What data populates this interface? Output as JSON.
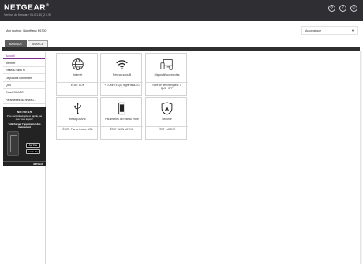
{
  "header": {
    "brand": "NETGEAR",
    "brand_mark": "®",
    "firmware": "Version du firmware V1.0.1.80_2.0.90",
    "icons": [
      "sync-icon",
      "help-icon",
      "power-icon"
    ]
  },
  "router": {
    "name_line": "Mon routeur : NightHawk R6700"
  },
  "language": {
    "selected": "Automatique",
    "caret": "▼"
  },
  "tabs": [
    {
      "label": "BASIQUE",
      "active": true
    },
    {
      "label": "AVANCÉ",
      "active": false
    }
  ],
  "sidebar": {
    "items": [
      {
        "label": "Accueil",
        "active": true
      },
      {
        "label": "Internet"
      },
      {
        "label": "Réseau sans fil"
      },
      {
        "label": "Dispositifs connectés"
      },
      {
        "label": "QoS"
      },
      {
        "label": "ReadySHARE"
      },
      {
        "label": "Paramètres du réseau..."
      }
    ]
  },
  "promo": {
    "brand": "NETGEAR",
    "tagline": "Plus contrôle simple et rapide, où que vous soyez !",
    "link": "Télécharger l'application dès maintenant",
    "app_store": "App Store",
    "google_play": "Google Play",
    "footer": "NETGEAR"
  },
  "cards": [
    {
      "title": "Internet",
      "status": "ÉTAT : BON",
      "icon": "globe-icon"
    },
    {
      "title": "Réseau sans fil",
      "status": "+ COMPTES(S) NightHawk-5G",
      "status2": "●●●",
      "icon": "wifi-icon"
    },
    {
      "title": "Dispositifs connectés",
      "status": "Nbre de périphériques : 3",
      "status2": "QoS : OFF",
      "icon": "devices-icon"
    },
    {
      "title": "ReadySHARE",
      "status": "ÉTAT : Pas de lecteur USB",
      "icon": "usb-icon"
    },
    {
      "title": "Paramètres du réseau invité",
      "status": "ÉTAT : NON ACTIVÉ",
      "icon": "phone-icon"
    },
    {
      "title": "Sécurité",
      "status": "ÉTAT : ACTIVÉ",
      "icon": "security-icon",
      "icon_letter": "A"
    }
  ],
  "colors": {
    "topbar": "#2e2e33",
    "accent": "#7b2a8e",
    "tab_active": "#5f5f5f"
  }
}
